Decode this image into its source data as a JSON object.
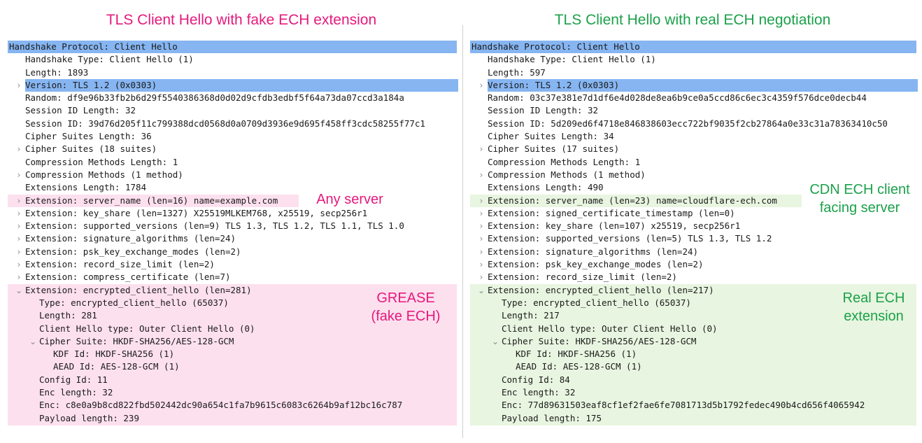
{
  "titles": {
    "left": "TLS Client Hello with fake ECH extension",
    "right": "TLS Client Hello with real ECH negotiation"
  },
  "colors": {
    "pink_title": "#e5197c",
    "green_title": "#1ba14a",
    "selection_blue": "#86b5f1",
    "pink_band": "#fde0ee",
    "green_band": "#e8f5e0"
  },
  "left": {
    "rows": [
      {
        "text": "Handshake Protocol: Client Hello",
        "indent": 0,
        "chevron": "",
        "hl": "blue-full"
      },
      {
        "text": "Handshake Type: Client Hello (1)",
        "indent": 1,
        "chevron": ""
      },
      {
        "text": "Length: 1893",
        "indent": 1,
        "chevron": ""
      },
      {
        "text": "Version: TLS 1.2 (0x0303)",
        "indent": 1,
        "chevron": ">",
        "hl": "blue"
      },
      {
        "text": "Random: df9e96b33fb2b6d29f5540386368d0d02d9cfdb3edbf5f64a73da07ccd3a184a",
        "indent": 1,
        "chevron": ""
      },
      {
        "text": "Session ID Length: 32",
        "indent": 1,
        "chevron": ""
      },
      {
        "text": "Session ID: 39d76d205f11c799388dcd0568d0a0709d3936e9d695f458ff3cdc58255f77c1",
        "indent": 1,
        "chevron": ""
      },
      {
        "text": "Cipher Suites Length: 36",
        "indent": 1,
        "chevron": ""
      },
      {
        "text": "Cipher Suites (18 suites)",
        "indent": 1,
        "chevron": ">"
      },
      {
        "text": "Compression Methods Length: 1",
        "indent": 1,
        "chevron": ""
      },
      {
        "text": "Compression Methods (1 method)",
        "indent": 1,
        "chevron": ">"
      },
      {
        "text": "Extensions Length: 1784",
        "indent": 1,
        "chevron": ""
      },
      {
        "text": "Extension: server_name (len=16) name=example.com",
        "indent": 1,
        "chevron": ">",
        "hl": "pink-row"
      },
      {
        "text": "Extension: key_share (len=1327) X25519MLKEM768, x25519, secp256r1",
        "indent": 1,
        "chevron": ">"
      },
      {
        "text": "Extension: supported_versions (len=9) TLS 1.3, TLS 1.2, TLS 1.1, TLS 1.0",
        "indent": 1,
        "chevron": ">"
      },
      {
        "text": "Extension: signature_algorithms (len=24)",
        "indent": 1,
        "chevron": ">"
      },
      {
        "text": "Extension: psk_key_exchange_modes (len=2)",
        "indent": 1,
        "chevron": ">"
      },
      {
        "text": "Extension: record_size_limit (len=2)",
        "indent": 1,
        "chevron": ">"
      },
      {
        "text": "Extension: compress_certificate (len=7)",
        "indent": 1,
        "chevron": ">"
      },
      {
        "text": "Extension: encrypted_client_hello (len=281)",
        "indent": 1,
        "chevron": "v"
      },
      {
        "text": "Type: encrypted_client_hello (65037)",
        "indent": 2,
        "chevron": ""
      },
      {
        "text": "Length: 281",
        "indent": 2,
        "chevron": ""
      },
      {
        "text": "Client Hello type: Outer Client Hello (0)",
        "indent": 2,
        "chevron": ""
      },
      {
        "text": "Cipher Suite: HKDF-SHA256/AES-128-GCM",
        "indent": 2,
        "chevron": "v"
      },
      {
        "text": "KDF Id: HKDF-SHA256 (1)",
        "indent": 3,
        "chevron": ""
      },
      {
        "text": "AEAD Id: AES-128-GCM (1)",
        "indent": 3,
        "chevron": ""
      },
      {
        "text": "Config Id: 11",
        "indent": 2,
        "chevron": ""
      },
      {
        "text": "Enc length: 32",
        "indent": 2,
        "chevron": ""
      },
      {
        "text": "Enc: c8e0a9b8cd822fbd502442dc90a654c1fa7b9615c6083c6264b9af12bc16c787",
        "indent": 2,
        "chevron": ""
      },
      {
        "text": "Payload length: 239",
        "indent": 2,
        "chevron": ""
      }
    ],
    "callouts": {
      "server": "Any server",
      "grease_line1": "GREASE",
      "grease_line2": "(fake ECH)"
    }
  },
  "right": {
    "rows": [
      {
        "text": "Handshake Protocol: Client Hello",
        "indent": 0,
        "chevron": "",
        "hl": "blue-full"
      },
      {
        "text": "Handshake Type: Client Hello (1)",
        "indent": 1,
        "chevron": ""
      },
      {
        "text": "Length: 597",
        "indent": 1,
        "chevron": ""
      },
      {
        "text": "Version: TLS 1.2 (0x0303)",
        "indent": 1,
        "chevron": ">",
        "hl": "blue"
      },
      {
        "text": "Random: 03c37e381e7d1df6e4d028de8ea6b9ce0a5ccd86c6ec3c4359f576dce0decb44",
        "indent": 1,
        "chevron": ""
      },
      {
        "text": "Session ID Length: 32",
        "indent": 1,
        "chevron": ""
      },
      {
        "text": "Session ID: 5d209ed6f4718e846838603ecc722bf9035f2cb27864a0e33c31a78363410c50",
        "indent": 1,
        "chevron": ""
      },
      {
        "text": "Cipher Suites Length: 34",
        "indent": 1,
        "chevron": ""
      },
      {
        "text": "Cipher Suites (17 suites)",
        "indent": 1,
        "chevron": ">"
      },
      {
        "text": "Compression Methods Length: 1",
        "indent": 1,
        "chevron": ""
      },
      {
        "text": "Compression Methods (1 method)",
        "indent": 1,
        "chevron": ">"
      },
      {
        "text": "Extensions Length: 490",
        "indent": 1,
        "chevron": ""
      },
      {
        "text": "Extension: server_name (len=23) name=cloudflare-ech.com",
        "indent": 1,
        "chevron": ">",
        "hl": "green-row"
      },
      {
        "text": "Extension: signed_certificate_timestamp (len=0)",
        "indent": 1,
        "chevron": ">"
      },
      {
        "text": "Extension: key_share (len=107) x25519, secp256r1",
        "indent": 1,
        "chevron": ">"
      },
      {
        "text": "Extension: supported_versions (len=5) TLS 1.3, TLS 1.2",
        "indent": 1,
        "chevron": ">"
      },
      {
        "text": "Extension: signature_algorithms (len=24)",
        "indent": 1,
        "chevron": ">"
      },
      {
        "text": "Extension: psk_key_exchange_modes (len=2)",
        "indent": 1,
        "chevron": ">"
      },
      {
        "text": "Extension: record_size_limit (len=2)",
        "indent": 1,
        "chevron": ">"
      },
      {
        "text": "Extension: encrypted_client_hello (len=217)",
        "indent": 1,
        "chevron": "v"
      },
      {
        "text": "Type: encrypted_client_hello (65037)",
        "indent": 2,
        "chevron": ""
      },
      {
        "text": "Length: 217",
        "indent": 2,
        "chevron": ""
      },
      {
        "text": "Client Hello type: Outer Client Hello (0)",
        "indent": 2,
        "chevron": ""
      },
      {
        "text": "Cipher Suite: HKDF-SHA256/AES-128-GCM",
        "indent": 2,
        "chevron": "v"
      },
      {
        "text": "KDF Id: HKDF-SHA256 (1)",
        "indent": 3,
        "chevron": ""
      },
      {
        "text": "AEAD Id: AES-128-GCM (1)",
        "indent": 3,
        "chevron": ""
      },
      {
        "text": "Config Id: 84",
        "indent": 2,
        "chevron": ""
      },
      {
        "text": "Enc length: 32",
        "indent": 2,
        "chevron": ""
      },
      {
        "text": "Enc: 77d89631503eaf8cf1ef2fae6fe7081713d5b1792fedec490b4cd656f4065942",
        "indent": 2,
        "chevron": ""
      },
      {
        "text": "Payload length: 175",
        "indent": 2,
        "chevron": ""
      }
    ],
    "callouts": {
      "server_line1": "CDN ECH client",
      "server_line2": "facing server",
      "ech_line1": "Real ECH",
      "ech_line2": "extension"
    }
  }
}
